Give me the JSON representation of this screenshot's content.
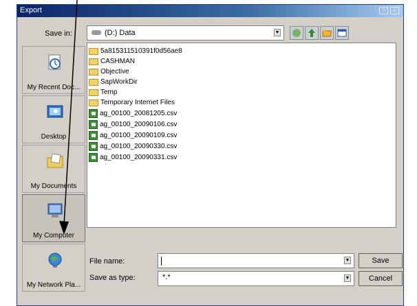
{
  "dialog": {
    "title": "Export",
    "save_in_label": "Save in:",
    "save_in_value": "(D:) Data",
    "file_name_label": "File name:",
    "file_name_value": "",
    "save_as_type_label": "Save as type:",
    "save_as_type_value": "*.*",
    "save_button": "Save",
    "cancel_button": "Cancel"
  },
  "places": [
    {
      "label": "My Recent Doc...",
      "icon": "recent-documents-icon"
    },
    {
      "label": "Desktop",
      "icon": "desktop-icon"
    },
    {
      "label": "My Documents",
      "icon": "my-documents-icon"
    },
    {
      "label": "My Computer",
      "icon": "my-computer-icon"
    },
    {
      "label": "My Network Pla...",
      "icon": "network-places-icon"
    }
  ],
  "files": [
    {
      "name": "5a815311510391f0d56ae8",
      "type": "folder"
    },
    {
      "name": "CASHMAN",
      "type": "folder"
    },
    {
      "name": "Objective",
      "type": "folder"
    },
    {
      "name": "SapWorkDir",
      "type": "folder"
    },
    {
      "name": "Temp",
      "type": "folder"
    },
    {
      "name": "Temporary Internet Files",
      "type": "folder"
    },
    {
      "name": "ag_00100_20081205.csv",
      "type": "csv"
    },
    {
      "name": "ag_00100_20090106.csv",
      "type": "csv"
    },
    {
      "name": "ag_00100_20090109.csv",
      "type": "csv"
    },
    {
      "name": "ag_00100_20090330.csv",
      "type": "csv"
    },
    {
      "name": "ag_00100_20090331.csv",
      "type": "csv"
    }
  ],
  "colors": {
    "title_bar": "#0a246a",
    "dialog_bg": "#d4d0c8",
    "annotation_arrow": "#000000"
  }
}
